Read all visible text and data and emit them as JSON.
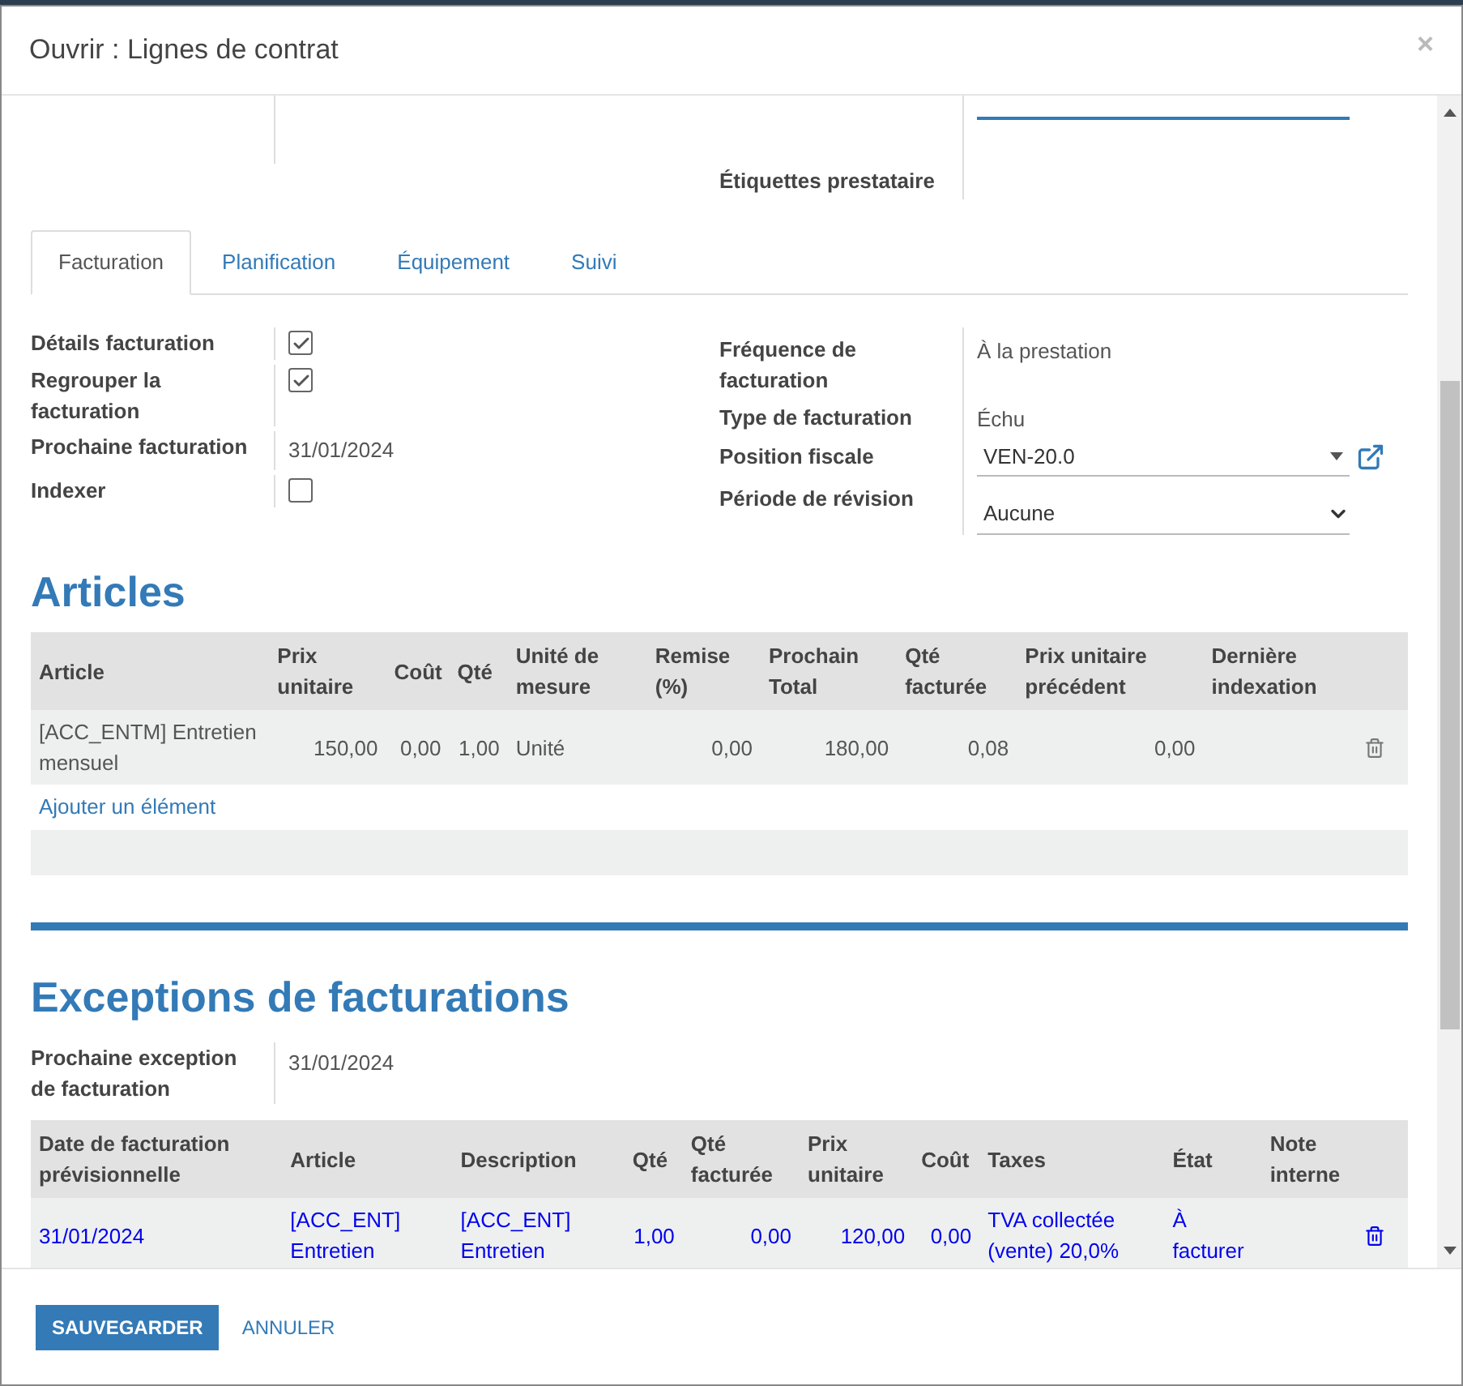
{
  "window": {
    "title": "Ouvrir : Lignes de contrat",
    "close": "×"
  },
  "top": {
    "label": "Étiquettes prestataire"
  },
  "tabs": [
    {
      "label": "Facturation",
      "selected": true
    },
    {
      "label": "Planification",
      "selected": false
    },
    {
      "label": "Équipement",
      "selected": false
    },
    {
      "label": "Suivi",
      "selected": false
    }
  ],
  "left_fields": [
    {
      "label": "Détails facturation",
      "kind": "checkbox",
      "checked": true
    },
    {
      "label": "Regrouper la facturation",
      "kind": "checkbox",
      "checked": true
    },
    {
      "label": "Prochaine facturation",
      "kind": "text",
      "value": "31/01/2024"
    },
    {
      "label": "Indexer",
      "kind": "checkbox",
      "checked": false
    }
  ],
  "right_fields": [
    {
      "label": "Fréquence de facturation",
      "kind": "text",
      "value": "À la prestation"
    },
    {
      "label": "Type de facturation",
      "kind": "text",
      "value": "Échu"
    },
    {
      "label": "Position fiscale",
      "kind": "many2one",
      "value": "VEN-20.0"
    },
    {
      "label": "Période de révision",
      "kind": "select",
      "value": "Aucune"
    }
  ],
  "articles": {
    "heading": "Articles",
    "columns": [
      {
        "label": "Article"
      },
      {
        "label": "Prix unitaire"
      },
      {
        "label": "Coût"
      },
      {
        "label": "Qté"
      },
      {
        "label": "Unité de mesure"
      },
      {
        "label": "Remise (%)"
      },
      {
        "label": "Prochain Total"
      },
      {
        "label": "Qté facturée"
      },
      {
        "label": "Prix unitaire précédent"
      },
      {
        "label": "Dernière indexation"
      }
    ],
    "rows": [
      {
        "cells": [
          "[ACC_ENTM] Entretien mensuel",
          "150,00",
          "0,00",
          "1,00",
          "Unité",
          "0,00",
          "180,00",
          "0,08",
          "0,00",
          ""
        ]
      }
    ],
    "add_link": "Ajouter un élément"
  },
  "exceptions": {
    "heading": "Exceptions de facturations",
    "field": {
      "label": "Prochaine exception de facturation",
      "value": "31/01/2024"
    },
    "columns": [
      {
        "label": "Date de facturation prévisionnelle"
      },
      {
        "label": "Article"
      },
      {
        "label": "Description"
      },
      {
        "label": "Qté"
      },
      {
        "label": "Qté facturée"
      },
      {
        "label": "Prix unitaire"
      },
      {
        "label": "Coût"
      },
      {
        "label": "Taxes"
      },
      {
        "label": "État"
      },
      {
        "label": "Note interne"
      }
    ],
    "rows": [
      {
        "cells": [
          "31/01/2024",
          "[ACC_ENT] Entretien",
          "[ACC_ENT] Entretien",
          "1,00",
          "0,00",
          "120,00",
          "0,00",
          "TVA collectée (vente) 20,0%",
          "À facturer",
          ""
        ]
      }
    ]
  },
  "footer": {
    "save": "SAUVEGARDER",
    "cancel": "ANNULER"
  }
}
